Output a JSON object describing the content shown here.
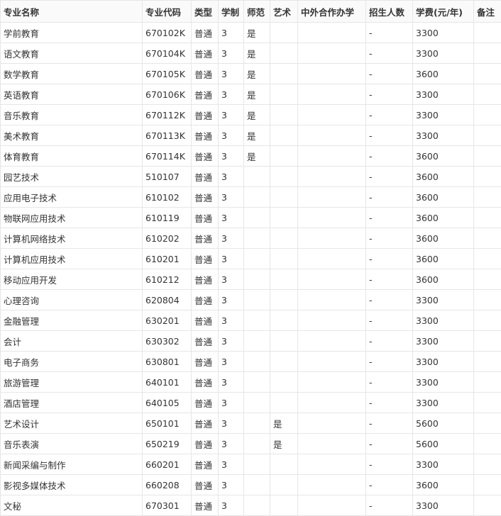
{
  "table": {
    "headers": [
      "专业名称",
      "专业代码",
      "类型",
      "学制",
      "师范",
      "艺术",
      "中外合作办学",
      "招生人数",
      "学费(元/年)",
      "备注"
    ],
    "rows": [
      [
        "学前教育",
        "670102K",
        "普通",
        "3",
        "是",
        "",
        "",
        "-",
        "3300",
        ""
      ],
      [
        "语文教育",
        "670104K",
        "普通",
        "3",
        "是",
        "",
        "",
        "-",
        "3300",
        ""
      ],
      [
        "数学教育",
        "670105K",
        "普通",
        "3",
        "是",
        "",
        "",
        "-",
        "3600",
        ""
      ],
      [
        "英语教育",
        "670106K",
        "普通",
        "3",
        "是",
        "",
        "",
        "-",
        "3300",
        ""
      ],
      [
        "音乐教育",
        "670112K",
        "普通",
        "3",
        "是",
        "",
        "",
        "-",
        "3300",
        ""
      ],
      [
        "美术教育",
        "670113K",
        "普通",
        "3",
        "是",
        "",
        "",
        "-",
        "3300",
        ""
      ],
      [
        "体育教育",
        "670114K",
        "普通",
        "3",
        "是",
        "",
        "",
        "-",
        "3600",
        ""
      ],
      [
        "园艺技术",
        "510107",
        "普通",
        "3",
        "",
        "",
        "",
        "-",
        "3600",
        ""
      ],
      [
        "应用电子技术",
        "610102",
        "普通",
        "3",
        "",
        "",
        "",
        "-",
        "3600",
        ""
      ],
      [
        "物联网应用技术",
        "610119",
        "普通",
        "3",
        "",
        "",
        "",
        "-",
        "3600",
        ""
      ],
      [
        "计算机网络技术",
        "610202",
        "普通",
        "3",
        "",
        "",
        "",
        "-",
        "3600",
        ""
      ],
      [
        "计算机应用技术",
        "610201",
        "普通",
        "3",
        "",
        "",
        "",
        "-",
        "3600",
        ""
      ],
      [
        "移动应用开发",
        "610212",
        "普通",
        "3",
        "",
        "",
        "",
        "-",
        "3600",
        ""
      ],
      [
        "心理咨询",
        "620804",
        "普通",
        "3",
        "",
        "",
        "",
        "-",
        "3300",
        ""
      ],
      [
        "金融管理",
        "630201",
        "普通",
        "3",
        "",
        "",
        "",
        "-",
        "3300",
        ""
      ],
      [
        "会计",
        "630302",
        "普通",
        "3",
        "",
        "",
        "",
        "-",
        "3300",
        ""
      ],
      [
        "电子商务",
        "630801",
        "普通",
        "3",
        "",
        "",
        "",
        "-",
        "3300",
        ""
      ],
      [
        "旅游管理",
        "640101",
        "普通",
        "3",
        "",
        "",
        "",
        "-",
        "3300",
        ""
      ],
      [
        "酒店管理",
        "640105",
        "普通",
        "3",
        "",
        "",
        "",
        "-",
        "3300",
        ""
      ],
      [
        "艺术设计",
        "650101",
        "普通",
        "3",
        "",
        "是",
        "",
        "-",
        "5600",
        ""
      ],
      [
        "音乐表演",
        "650219",
        "普通",
        "3",
        "",
        "是",
        "",
        "-",
        "5600",
        ""
      ],
      [
        "新闻采编与制作",
        "660201",
        "普通",
        "3",
        "",
        "",
        "",
        "-",
        "3300",
        ""
      ],
      [
        "影视多媒体技术",
        "660208",
        "普通",
        "3",
        "",
        "",
        "",
        "-",
        "3600",
        ""
      ],
      [
        "文秘",
        "670301",
        "普通",
        "3",
        "",
        "",
        "",
        "-",
        "3300",
        ""
      ]
    ]
  }
}
